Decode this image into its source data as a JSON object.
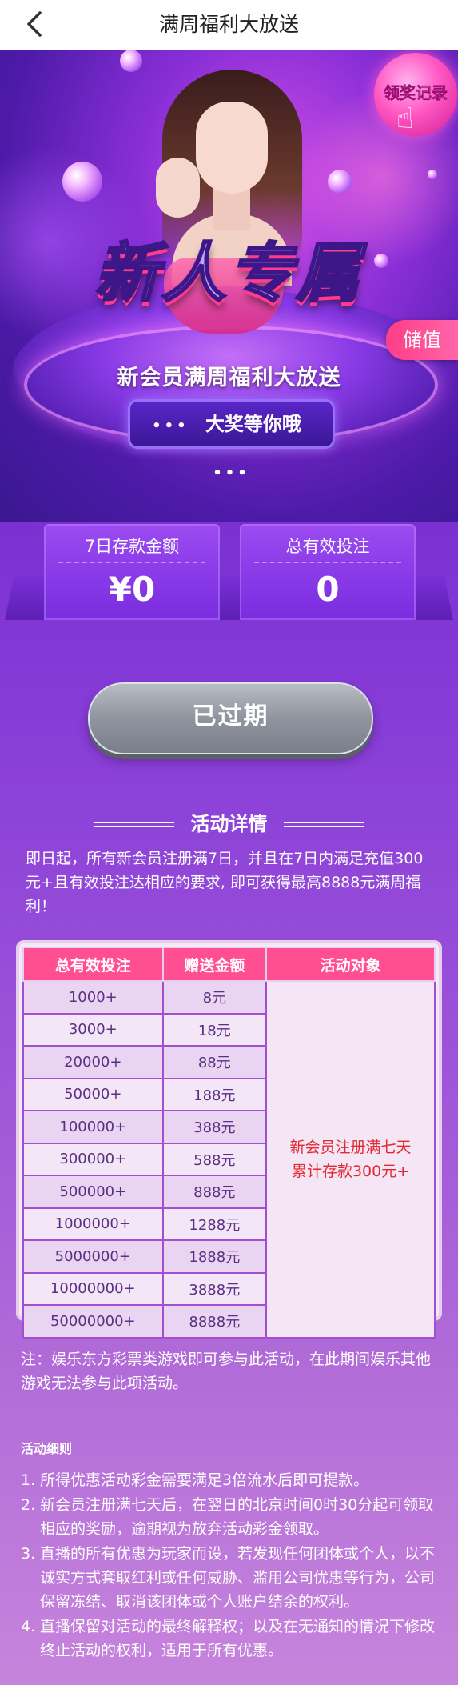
{
  "nav": {
    "title": "满周福利大放送",
    "back_icon": "chevron-left-icon"
  },
  "banner": {
    "headline": "新人专属",
    "subline": "新会员满周福利大放送",
    "pill_dots_left": "•••",
    "pill_text": "大奖等你哦",
    "pill_dots_right": "•••",
    "record_button": "领奖记录",
    "recharge_tab": "储值"
  },
  "stats": [
    {
      "label": "7日存款金额",
      "value": "¥0"
    },
    {
      "label": "总有效投注",
      "value": "0"
    }
  ],
  "status_button": "已过期",
  "details": {
    "title": "活动详情",
    "description": "即日起，所有新会员注册满7日，并且在7日内满足充值300元+且有效投注达相应的要求, 即可获得最高8888元满周福利！"
  },
  "table": {
    "headers": [
      "总有效投注",
      "赠送金额",
      "活动对象"
    ],
    "rows": [
      [
        "1000+",
        "8元"
      ],
      [
        "3000+",
        "18元"
      ],
      [
        "20000+",
        "88元"
      ],
      [
        "50000+",
        "188元"
      ],
      [
        "100000+",
        "388元"
      ],
      [
        "300000+",
        "588元"
      ],
      [
        "500000+",
        "888元"
      ],
      [
        "1000000+",
        "1288元"
      ],
      [
        "5000000+",
        "1888元"
      ],
      [
        "10000000+",
        "3888元"
      ],
      [
        "50000000+",
        "8888元"
      ]
    ],
    "target_line1": "新会员注册满七天",
    "target_line2": "累计存款300元+"
  },
  "note": "注：娱乐东方彩票类游戏即可参与此活动，在此期间娱乐其他游戏无法参与此项活动。",
  "rules": {
    "title": "活动细则",
    "items": [
      "所得优惠活动彩金需要满足3倍流水后即可提款。",
      "新会员注册满七天后，在翌日的北京时间0时30分起可领取相应的奖励，逾期视为放弃活动彩金领取。",
      "直播的所有优惠为玩家而设，若发现任何团体或个人，以不诚实方式套取红利或任何威胁、滥用公司优惠等行为，公司保留冻结、取消该团体或个人账户结余的权利。",
      "直播保留对活动的最终解释权；以及在无通知的情况下修改终止活动的权利，适用于所有优惠。"
    ]
  },
  "colors": {
    "accent_pink": "#ff4f92",
    "table_text": "#5b2f82",
    "target_red": "#e3292f"
  }
}
